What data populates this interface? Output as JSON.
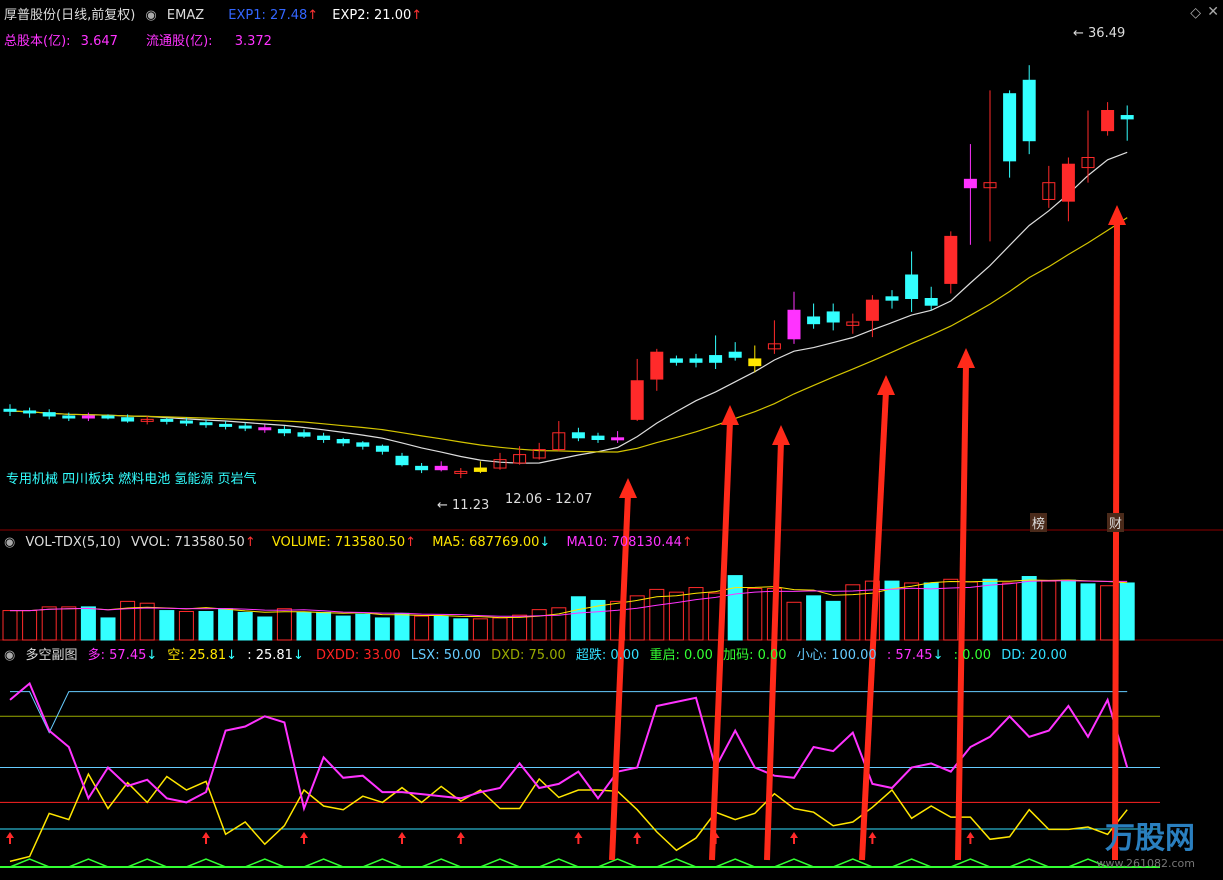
{
  "colors": {
    "up": "#ff2a2a",
    "down": "#33ffff",
    "yellow": "#ffe600",
    "magenta": "#ff33ff",
    "white": "#dddddd",
    "ma2": "#d4c500",
    "green": "#33ff33",
    "arrow": "#ff2a1a",
    "lightblue": "#66ccff",
    "olive": "#99aa00",
    "orangeRed": "#ff2222",
    "cyan": "#33e0ff",
    "divider": "#8b0000"
  },
  "main": {
    "title": "厚普股份(日线,前复权)",
    "indicator": "EMAZ",
    "exp1_label": "EXP1: 27.48",
    "exp2_label": "EXP2: 21.00",
    "total_shares_label": "总股本(亿):",
    "total_shares_value": "3.647",
    "float_shares_label": "流通股(亿):",
    "float_shares_value": "3.372",
    "sector_tags": "专用机械 四川板块 燃料电池 氢能源 页岩气",
    "high_label": "36.49",
    "low_label": "11.23",
    "range_label": "12.06 - 12.07",
    "badge1": "榜",
    "badge2": "财"
  },
  "vol": {
    "title": "VOL-TDX(5,10)",
    "vvol": "VVOL: 713580.50",
    "volume": "VOLUME: 713580.50",
    "ma5": "MA5: 687769.00",
    "ma10": "MA10: 708130.44"
  },
  "sub": {
    "title": "多空副图",
    "duo": "多: 57.45",
    "kong": "空: 25.81",
    "blank": ": 25.81",
    "dxdd": "DXDD: 33.00",
    "lsx": "LSX: 50.00",
    "dxd": "DXD: 75.00",
    "chaodie": "超跌: 0.00",
    "chongqi": "重启: 0.00",
    "jiama": "加码: 0.00",
    "xiaoxin": "小心: 100.00",
    "v1": ": 57.45",
    "v2": ": 0.00",
    "dd": "DD: 20.00"
  },
  "watermark": {
    "text": "万股网",
    "url": "www.261082.com"
  },
  "chart_data": {
    "type": "candlestick",
    "price_ylim": [
      10,
      38
    ],
    "candles": [
      [
        16,
        15.9,
        16.3,
        15.6
      ],
      [
        15.9,
        15.8,
        16.1,
        15.5
      ],
      [
        15.8,
        15.6,
        16.0,
        15.4
      ],
      [
        15.6,
        15.5,
        15.8,
        15.3
      ],
      [
        15.5,
        15.6,
        15.8,
        15.3
      ],
      [
        15.6,
        15.5,
        15.7,
        15.4
      ],
      [
        15.5,
        15.3,
        15.7,
        15.2
      ],
      [
        15.3,
        15.4,
        15.6,
        15.1
      ],
      [
        15.4,
        15.3,
        15.5,
        15.1
      ],
      [
        15.3,
        15.2,
        15.5,
        15.0
      ],
      [
        15.2,
        15.1,
        15.4,
        14.9
      ],
      [
        15.1,
        15.0,
        15.3,
        14.8
      ],
      [
        15.0,
        14.9,
        15.2,
        14.7
      ],
      [
        14.9,
        14.8,
        15.1,
        14.6
      ],
      [
        14.8,
        14.6,
        15.0,
        14.4
      ],
      [
        14.6,
        14.4,
        14.8,
        14.3
      ],
      [
        14.4,
        14.2,
        14.6,
        14.0
      ],
      [
        14.2,
        14.0,
        14.3,
        13.8
      ],
      [
        14.0,
        13.8,
        14.1,
        13.6
      ],
      [
        13.8,
        13.5,
        13.9,
        13.3
      ],
      [
        13.2,
        12.7,
        13.4,
        12.6
      ],
      [
        12.6,
        12.4,
        12.8,
        12.2
      ],
      [
        12.4,
        12.6,
        12.9,
        12.3
      ],
      [
        12.2,
        12.3,
        12.5,
        11.9
      ],
      [
        12.3,
        12.5,
        12.9,
        12.2
      ],
      [
        12.5,
        13.0,
        13.4,
        12.4
      ],
      [
        12.8,
        13.3,
        13.8,
        12.7
      ],
      [
        13.1,
        13.6,
        14.0,
        13.0
      ],
      [
        13.6,
        14.6,
        15.3,
        13.5
      ],
      [
        14.6,
        14.3,
        14.9,
        14.1
      ],
      [
        14.4,
        14.2,
        14.6,
        14.0
      ],
      [
        14.2,
        14.3,
        14.7,
        14.0
      ],
      [
        15.4,
        17.7,
        19.0,
        15.3
      ],
      [
        17.8,
        19.4,
        19.6,
        17.1
      ],
      [
        19.0,
        18.8,
        19.2,
        18.6
      ],
      [
        19.0,
        18.8,
        19.3,
        18.5
      ],
      [
        19.2,
        18.8,
        20.4,
        18.4
      ],
      [
        19.4,
        19.1,
        20.0,
        18.9
      ],
      [
        18.6,
        19.0,
        19.8,
        18.2
      ],
      [
        19.6,
        19.9,
        21.3,
        19.3
      ],
      [
        20.2,
        21.9,
        23.0,
        19.9
      ],
      [
        21.5,
        21.1,
        22.3,
        20.8
      ],
      [
        21.8,
        21.2,
        22.3,
        20.7
      ],
      [
        21.0,
        21.2,
        21.7,
        20.5
      ],
      [
        21.3,
        22.5,
        22.8,
        20.3
      ],
      [
        22.7,
        22.5,
        23.1,
        22.0
      ],
      [
        24.0,
        22.6,
        25.4,
        21.8
      ],
      [
        22.6,
        22.2,
        23.3,
        21.9
      ],
      [
        23.5,
        26.3,
        26.6,
        22.9
      ],
      [
        29.2,
        29.7,
        31.8,
        25.8
      ],
      [
        29.2,
        29.5,
        35.0,
        26.0
      ],
      [
        34.8,
        30.8,
        35.0,
        29.8
      ],
      [
        35.6,
        32.0,
        36.5,
        31.2
      ],
      [
        28.5,
        29.5,
        30.5,
        28.0
      ],
      [
        28.4,
        30.6,
        31.0,
        27.2
      ],
      [
        30.4,
        31.0,
        33.8,
        29.5
      ],
      [
        32.6,
        33.8,
        34.3,
        32.3
      ],
      [
        33.5,
        33.3,
        34.1,
        32.0
      ]
    ],
    "volume_ylim": [
      0,
      1000000
    ],
    "volumes": [
      320,
      320,
      360,
      360,
      360,
      240,
      420,
      400,
      320,
      310,
      310,
      340,
      300,
      250,
      340,
      300,
      300,
      260,
      280,
      240,
      290,
      260,
      260,
      230,
      230,
      240,
      270,
      330,
      350,
      470,
      430,
      420,
      480,
      550,
      520,
      570,
      510,
      700,
      560,
      560,
      410,
      480,
      420,
      600,
      640,
      640,
      620,
      620,
      660,
      630,
      660,
      620,
      690,
      640,
      650,
      610,
      590,
      620
    ],
    "volume_up": [
      1,
      1,
      1,
      1,
      0,
      0,
      1,
      1,
      0,
      1,
      0,
      0,
      0,
      0,
      1,
      0,
      0,
      0,
      0,
      0,
      0,
      1,
      0,
      0,
      1,
      1,
      1,
      1,
      1,
      0,
      0,
      1,
      1,
      1,
      1,
      1,
      1,
      0,
      1,
      1,
      1,
      0,
      0,
      1,
      1,
      0,
      1,
      0,
      1,
      1,
      0,
      1,
      0,
      1,
      0,
      0,
      1,
      0
    ],
    "duo": [
      83,
      91,
      68,
      60,
      35,
      50,
      41,
      44,
      35,
      33,
      38,
      68,
      70,
      75,
      72,
      30,
      55,
      45,
      46,
      38,
      38,
      37,
      36,
      35,
      38,
      40,
      52,
      40,
      42,
      48,
      35,
      48,
      50,
      80,
      82,
      84,
      50,
      68,
      50,
      46,
      45,
      60,
      58,
      67,
      42,
      40,
      50,
      52,
      48,
      60,
      65,
      75,
      65,
      68,
      80,
      65,
      83,
      50
    ],
    "lsx": [
      87,
      87,
      67,
      87,
      87,
      87,
      87,
      87,
      87,
      87,
      87,
      87,
      87,
      87,
      87,
      87,
      87,
      87,
      87,
      87,
      87,
      87,
      87,
      87,
      87,
      87,
      87,
      87,
      87,
      87,
      87,
      87,
      87,
      87,
      87,
      87,
      87,
      87,
      87,
      87,
      87,
      87,
      87,
      87,
      87,
      87,
      87,
      87,
      87,
      87,
      87,
      87,
      87,
      87,
      87,
      87,
      87,
      87
    ]
  }
}
